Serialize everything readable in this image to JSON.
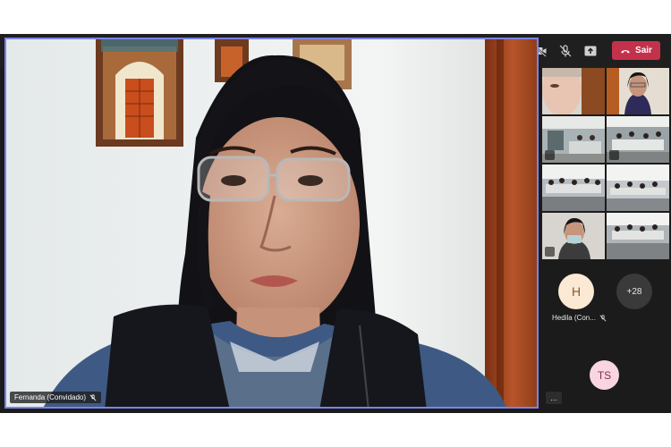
{
  "toolbar": {
    "timer": "--:--",
    "leave_label": "Sair",
    "icons": [
      "people-icon",
      "chat-icon",
      "reactions-icon",
      "more-icon",
      "camera-off-icon",
      "mic-off-icon",
      "share-icon",
      "phone-icon"
    ]
  },
  "main_video": {
    "participant_name": "Fernanda (Convidado)"
  },
  "sidebar": {
    "participant_h_initial": "H",
    "participant_h_name": "Hedila (Con...",
    "overflow_count": "+28",
    "participant_ts_initials": "TS",
    "more_label": "..."
  },
  "colors": {
    "leave_button": "#c4314b",
    "active_speaker_border": "#7b83eb",
    "avatar_h_bg": "#fbe9d4",
    "avatar_ts_bg": "#f8d5e0"
  }
}
